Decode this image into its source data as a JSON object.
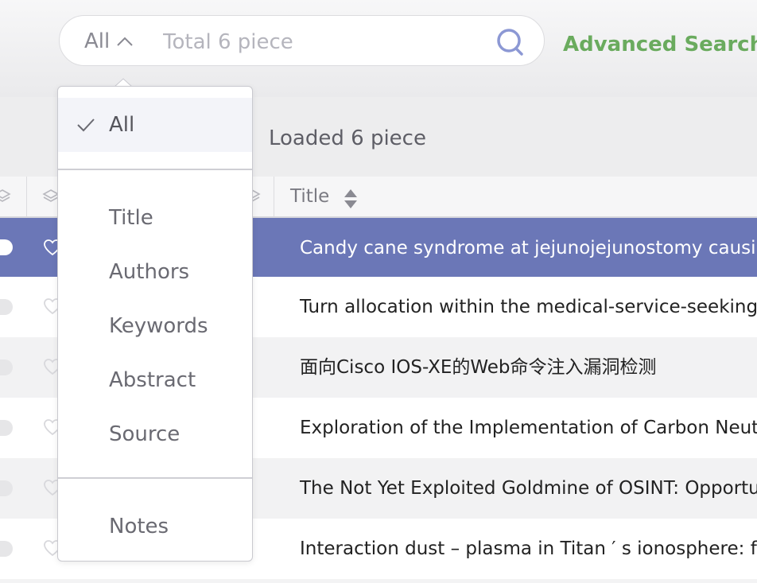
{
  "search": {
    "scope": "All",
    "placeholder": "Total 6 piece",
    "value": "",
    "advanced_label": "Advanced Search"
  },
  "status": {
    "loaded_text": "Loaded 6 piece"
  },
  "table": {
    "title_header": "Title",
    "rows": [
      {
        "title": "Candy cane syndrome at jejunojejunostomy causing sm",
        "selected": true
      },
      {
        "title": "Turn allocation within the medical-service-seeking part"
      },
      {
        "title": "面向Cisco IOS-XE的Web命令注入漏洞检测"
      },
      {
        "title": "Exploration of the Implementation of Carbon Neutraliz"
      },
      {
        "title": "The Not Yet Exploited Goldmine of OSINT: Opportuniti"
      },
      {
        "title": "Interaction dust – plasma in Titan ′ s ionosphere: feedb"
      }
    ]
  },
  "dropdown": {
    "items": [
      {
        "label": "All",
        "selected": true
      },
      {
        "label": "Title"
      },
      {
        "label": "Authors"
      },
      {
        "label": "Keywords"
      },
      {
        "label": "Abstract"
      },
      {
        "label": "Source"
      },
      {
        "label": "Notes"
      }
    ]
  },
  "colors": {
    "accent": "#6b77b7",
    "advanced": "#6aab5e",
    "search_icon": "#8c98d4"
  }
}
